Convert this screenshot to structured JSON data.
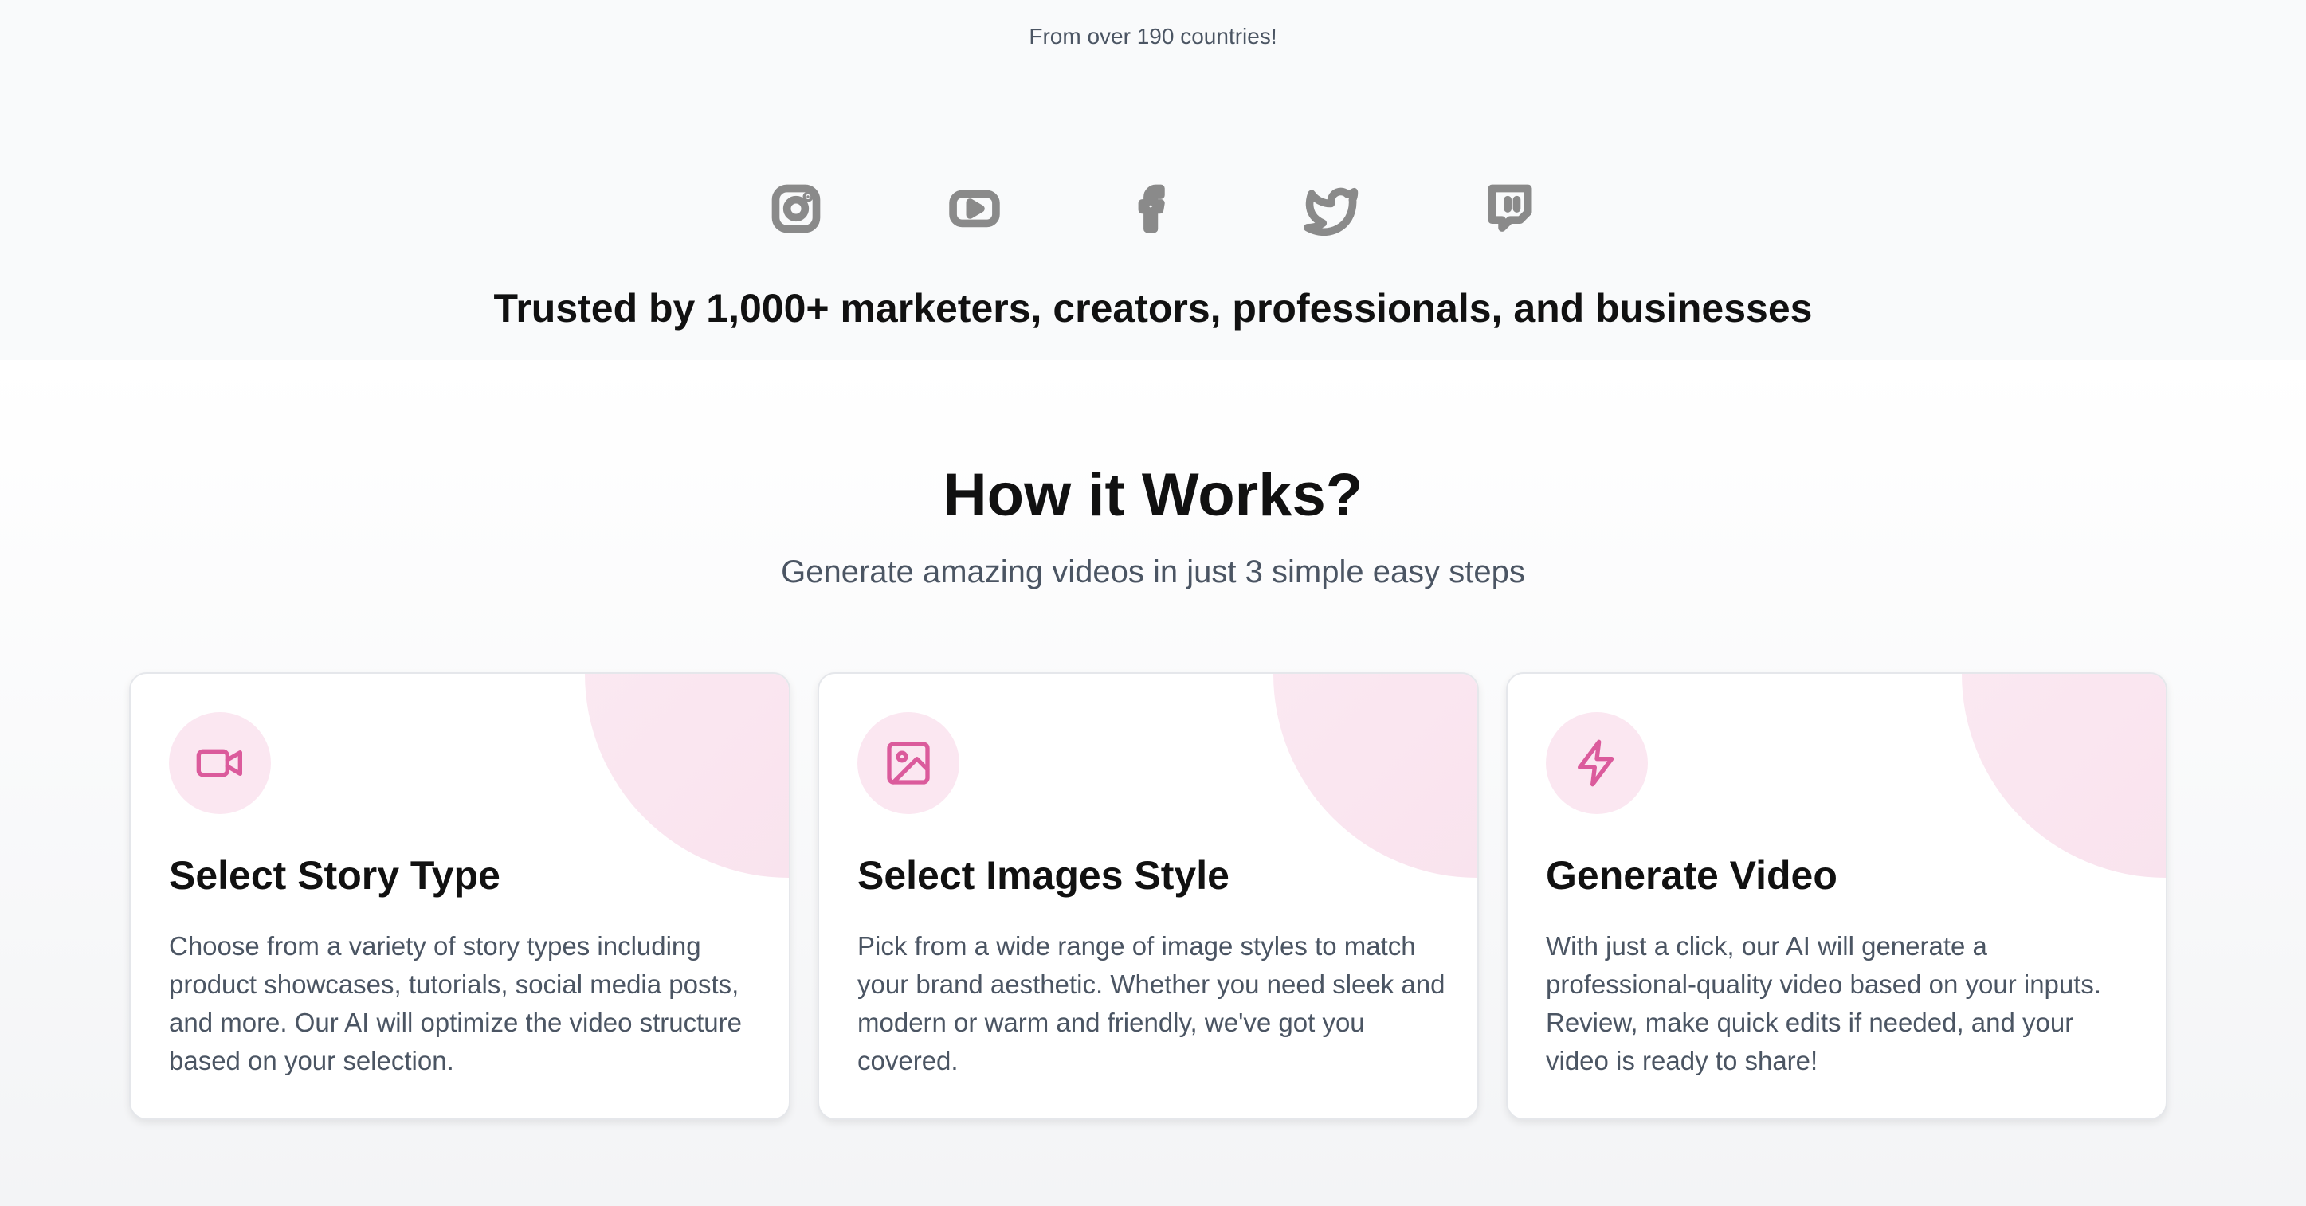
{
  "trusted": {
    "countries_text": "From over 190 countries!",
    "socials": [
      {
        "icon": "instagram-icon"
      },
      {
        "icon": "youtube-icon"
      },
      {
        "icon": "facebook-icon"
      },
      {
        "icon": "twitter-icon"
      },
      {
        "icon": "twitch-icon"
      }
    ],
    "title": "Trusted by 1,000+ marketers, creators, professionals, and businesses"
  },
  "how_it_works": {
    "title": "How it Works?",
    "subtitle": "Generate amazing videos in just 3 simple easy steps",
    "accent_color": "#db5b9c",
    "steps": [
      {
        "icon": "video-camera-icon",
        "title": "Select Story Type",
        "description": "Choose from a variety of story types including product showcases, tutorials, social media posts, and more. Our AI will optimize the video structure based on your selection."
      },
      {
        "icon": "image-icon",
        "title": "Select Images Style",
        "description": "Pick from a wide range of image styles to match your brand aesthetic. Whether you need sleek and modern or warm and friendly, we've got you covered."
      },
      {
        "icon": "lightning-bolt-icon",
        "title": "Generate Video",
        "description": "With just a click, our AI will generate a professional-quality video based on your inputs. Review, make quick edits if needed, and your video is ready to share!"
      }
    ]
  }
}
